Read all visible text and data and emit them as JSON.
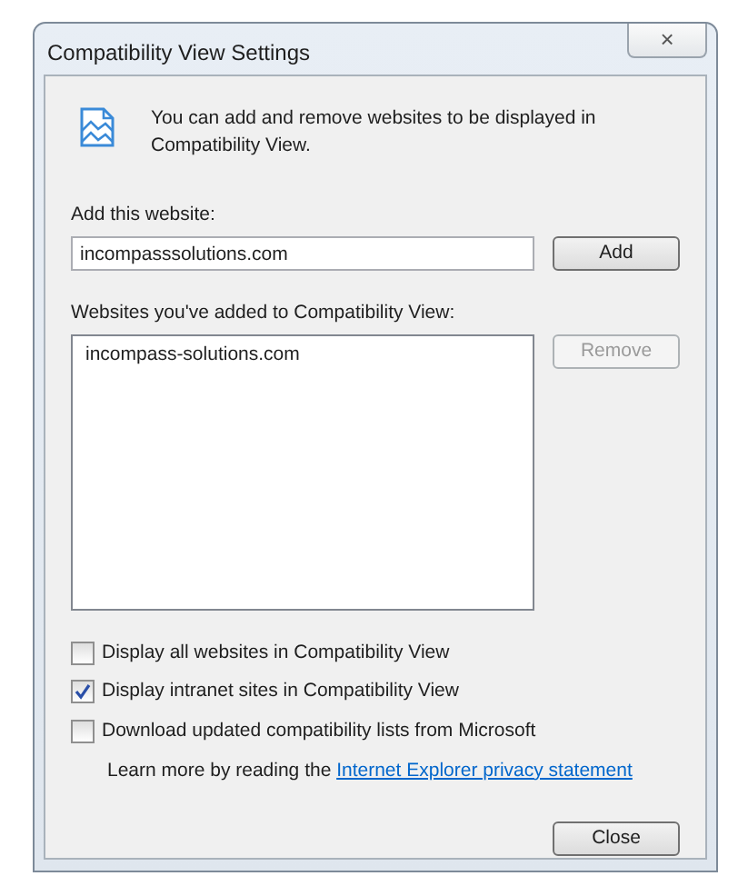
{
  "window": {
    "title": "Compatibility View Settings",
    "close_glyph": "×"
  },
  "intro": "You can add and remove websites to be displayed in Compatibility View.",
  "add_field": {
    "label": "Add this website:",
    "value": "incompasssolutions.com"
  },
  "add_button": {
    "label": "Add",
    "disabled": false
  },
  "list": {
    "label": "Websites you've added to Compatibility View:",
    "items": [
      {
        "text": "incompass-solutions.com",
        "selected": false
      }
    ]
  },
  "remove_button": {
    "label": "Remove",
    "disabled": true
  },
  "options": [
    {
      "label": "Display all websites in Compatibility View",
      "checked": false
    },
    {
      "label": "Display intranet sites in Compatibility View",
      "checked": true
    },
    {
      "label": "Download updated compatibility lists from Microsoft",
      "checked": false
    }
  ],
  "learn_more": {
    "text": "Learn more by reading the",
    "link": "Internet Explorer privacy statement"
  },
  "close_button": {
    "label": "Close",
    "disabled": false
  }
}
